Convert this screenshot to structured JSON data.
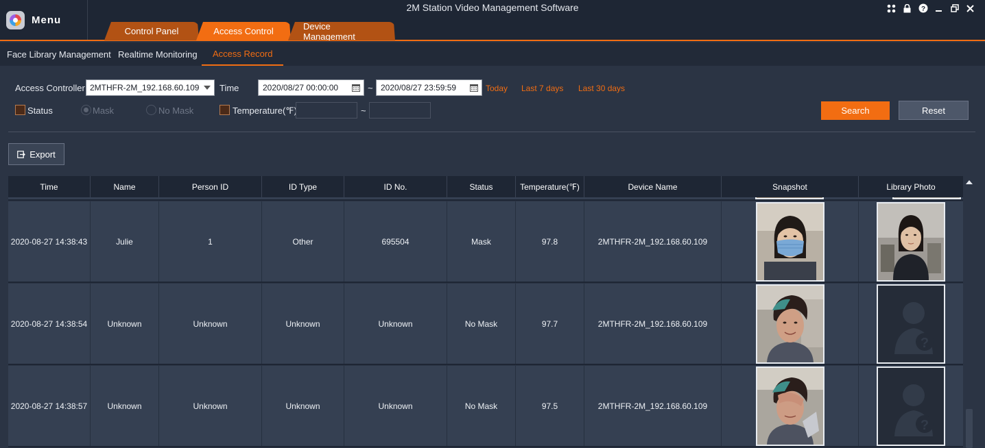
{
  "app": {
    "menu_label": "Menu",
    "title": "2M Station Video Management Software"
  },
  "tabs": [
    {
      "label": "Control Panel",
      "active": false
    },
    {
      "label": "Access Control",
      "active": true
    },
    {
      "label": "Device Management",
      "active": false
    }
  ],
  "subnav": [
    {
      "label": "Face Library Management",
      "active": false
    },
    {
      "label": "Realtime Monitoring",
      "active": false
    },
    {
      "label": "Access Record",
      "active": true
    }
  ],
  "filters": {
    "access_controller_label": "Access Controller",
    "access_controller_value": "2MTHFR-2M_192.168.60.109",
    "time_label": "Time",
    "time_start": "2020/08/27 00:00:00",
    "time_separator": "~",
    "time_end": "2020/08/27 23:59:59",
    "quick": [
      "Today",
      "Last 7 days",
      "Last 30 days"
    ],
    "status_label": "Status",
    "mask_label": "Mask",
    "no_mask_label": "No Mask",
    "temperature_label": "Temperature(℉)",
    "temp_separator": "~",
    "search_label": "Search",
    "reset_label": "Reset"
  },
  "export_label": "Export",
  "table": {
    "columns": [
      "Time",
      "Name",
      "Person ID",
      "ID Type",
      "ID No.",
      "Status",
      "Temperature(℉)",
      "Device Name",
      "Snapshot",
      "Library Photo"
    ],
    "rows": [
      {
        "time": "2020-08-27 14:38:43",
        "name": "Julie",
        "person_id": "1",
        "id_type": "Other",
        "id_no": "695504",
        "status": "Mask",
        "temperature": "97.8",
        "device": "2MTHFR-2M_192.168.60.109"
      },
      {
        "time": "2020-08-27 14:38:54",
        "name": "Unknown",
        "person_id": "Unknown",
        "id_type": "Unknown",
        "id_no": "Unknown",
        "status": "No Mask",
        "temperature": "97.7",
        "device": "2MTHFR-2M_192.168.60.109"
      },
      {
        "time": "2020-08-27 14:38:57",
        "name": "Unknown",
        "person_id": "Unknown",
        "id_type": "Unknown",
        "id_no": "Unknown",
        "status": "No Mask",
        "temperature": "97.5",
        "device": "2MTHFR-2M_192.168.60.109"
      }
    ]
  },
  "colors": {
    "accent": "#f26d12",
    "background": "#2b3444",
    "header": "#1e2634",
    "row": "#354052"
  }
}
